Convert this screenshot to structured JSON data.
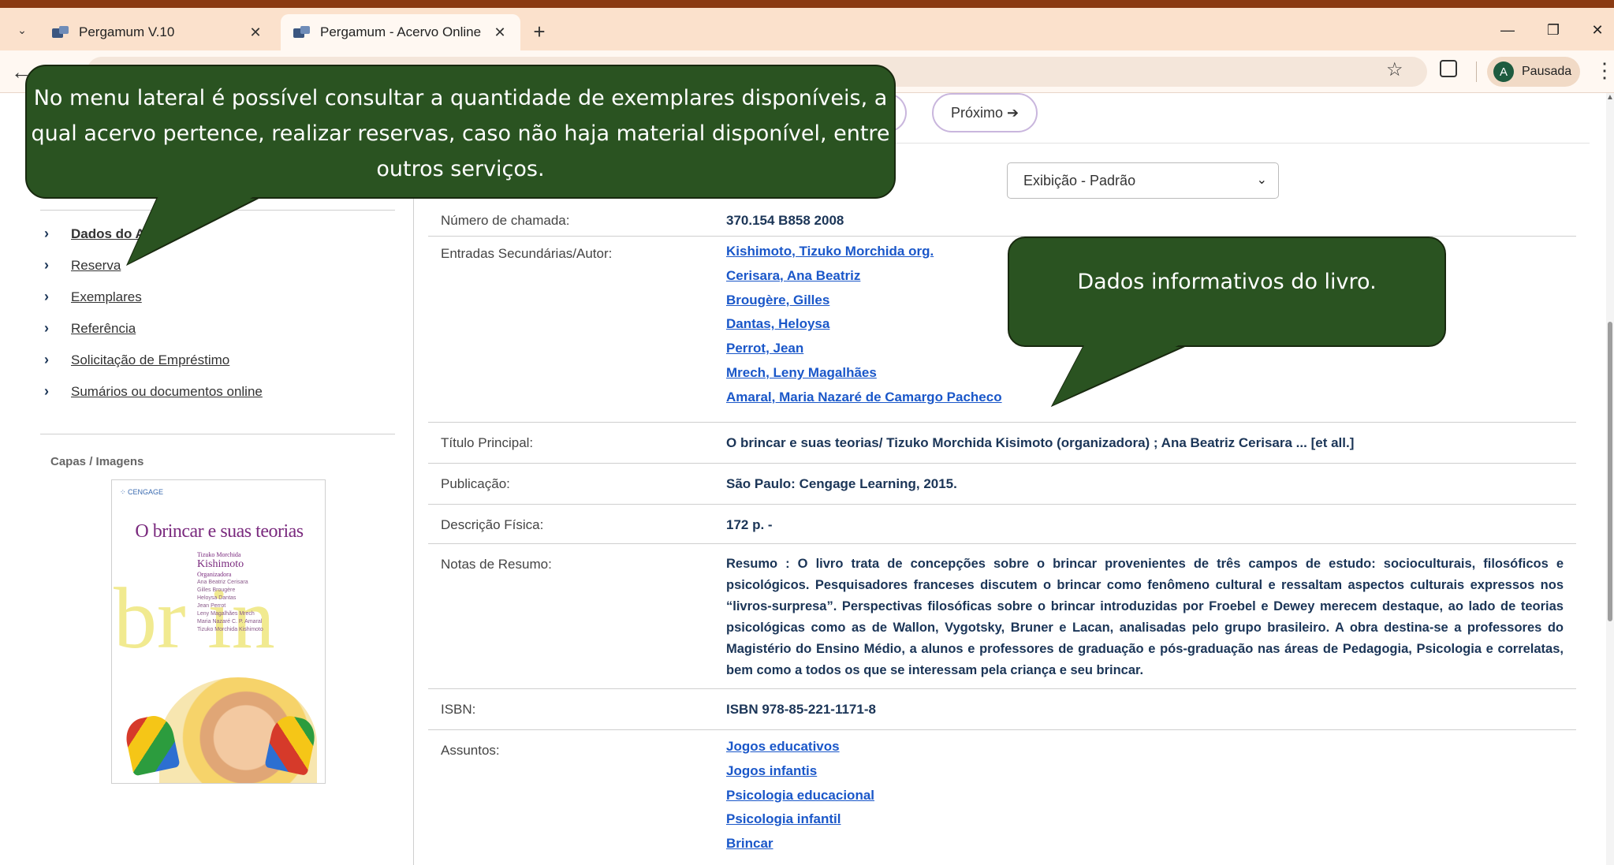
{
  "browser": {
    "tabs": [
      {
        "title": "Pergamum V.10",
        "active": false
      },
      {
        "title": "Pergamum - Acervo Online",
        "active": true
      }
    ],
    "profile_initial": "A",
    "profile_label": "Pausada"
  },
  "nav": {
    "next_label": "Próximo ➔"
  },
  "view_select": {
    "selected": "Exibição - Padrão"
  },
  "sidebar": {
    "items": [
      {
        "label": "Dados do Ac"
      },
      {
        "label": "Reserva"
      },
      {
        "label": "Exemplares"
      },
      {
        "label": "Referência"
      },
      {
        "label": "Solicitação de Empréstimo"
      },
      {
        "label": "Sumários ou documentos online"
      }
    ],
    "capas_heading": "Capas / Imagens"
  },
  "cover": {
    "publisher": "⁘ CENGAGE",
    "title": "O brincar e suas teorias",
    "author_first": "Tizuko Morchida",
    "author_last": "Kishimoto",
    "author_role": "Organizadora",
    "contributors": [
      "Ana Beatriz Cerisara",
      "Gilles Brougère",
      "Heloysa Dantas",
      "Jean Perrot",
      "Leny Magalhães Mrech",
      "Maria Nazaré C. P. Amaral",
      "Tizuko Morchida Kishimoto"
    ],
    "big_letters": "br in"
  },
  "record": {
    "call_number": {
      "label": "Número de chamada:",
      "value": "370.154  B858  2008"
    },
    "secondary_entries": {
      "label": "Entradas Secundárias/Autor:",
      "values": [
        "Kishimoto, Tizuko Morchida org.",
        "Cerisara, Ana Beatriz",
        "Brougère, Gilles",
        "Dantas, Heloysa",
        "Perrot, Jean",
        "Mrech, Leny Magalhães",
        "Amaral, Maria Nazaré de Camargo Pacheco"
      ]
    },
    "main_title": {
      "label": "Título Principal:",
      "value": "O brincar e suas teorias/  Tizuko Morchida Kisimoto (organizadora) ; Ana Beatriz Cerisara ... [et all.]"
    },
    "publication": {
      "label": "Publicação:",
      "value": "São Paulo:  Cengage Learning,  2015."
    },
    "physical": {
      "label": "Descrição Física:",
      "value": "172 p. -"
    },
    "summary": {
      "label": "Notas de Resumo:",
      "value": "Resumo : O livro trata de concepções sobre o brincar provenientes de três campos de estudo: socioculturais, filosóficos e psicológicos. Pesquisadores franceses discutem o brincar como fenômeno cultural e ressaltam aspectos culturais expressos nos “livros-surpresa”. Perspectivas filosóficas sobre o brincar introduzidas por Froebel e Dewey merecem destaque, ao lado de teorias psicológicas como as de Wallon, Vygotsky, Bruner e Lacan, analisadas pelo grupo brasileiro. A obra destina-se a professores do Magistério do Ensino Médio, a alunos e professores de graduação e pós-graduação nas áreas de Pedagogia, Psicologia e correlatas, bem como a todos os que se interessam pela criança e seu brincar."
    },
    "isbn": {
      "label": "ISBN:",
      "value": "ISBN 978-85-221-1171-8"
    },
    "subjects": {
      "label": "Assuntos:",
      "values": [
        "Jogos educativos",
        "Jogos infantis",
        "Psicologia educacional",
        "Psicologia infantil",
        "Brincar"
      ]
    }
  },
  "callouts": {
    "sidebar_note": "No menu lateral é possível consultar a quantidade de exemplares disponíveis, a qual acervo pertence, realizar reservas, caso não haja material disponível, entre outros serviços.",
    "data_note": "Dados informativos do livro."
  },
  "colors": {
    "callout_bg": "#2a5321",
    "link": "#1a57c9",
    "value_text": "#1b3557",
    "tabbar": "#fbe1cc"
  }
}
